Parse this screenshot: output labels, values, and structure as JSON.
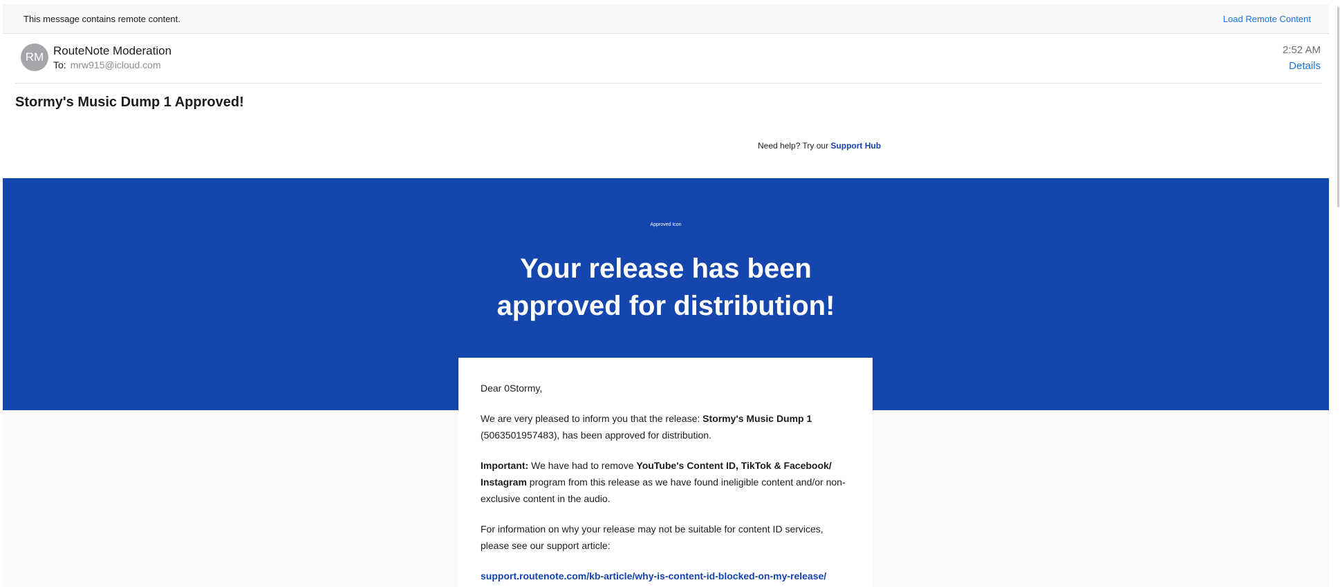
{
  "remote_banner": {
    "message": "This message contains remote content.",
    "action": "Load Remote Content"
  },
  "header": {
    "avatar_initials": "RM",
    "sender": "RouteNote Moderation",
    "to_label": "To:",
    "to_address": "mrw915@icloud.com",
    "time": "2:52 AM",
    "details_label": "Details"
  },
  "subject": "Stormy's Music Dump 1 Approved!",
  "help": {
    "prefix": "Need help? Try our ",
    "link": "Support Hub"
  },
  "hero": {
    "icon_alt": "Approved Icon",
    "title": "Your release has been approved for distribution!"
  },
  "card": {
    "greeting": "Dear 0Stormy,",
    "p1_prefix": "We are very pleased to inform you that the release: ",
    "p1_release": "Stormy's Music Dump 1",
    "p1_suffix": " (5063501957483), has been approved for distribution.",
    "p2_label": "Important:",
    "p2_text": " We have had to remove ",
    "p2_programs": "YouTube's Content ID, TikTok & Facebook/ Instagram",
    "p2_suffix": " program from this release as we have found ineligible content and/or non-exclusive content in the audio.",
    "p3": "For information on why your release may not be suitable for content ID services, please see our support article:",
    "link": "support.routenote.com/kb-article/why-is-content-id-blocked-on-my-release/"
  },
  "colors": {
    "brand_blue": "#1446ad",
    "link_blue": "#1a73d9"
  }
}
